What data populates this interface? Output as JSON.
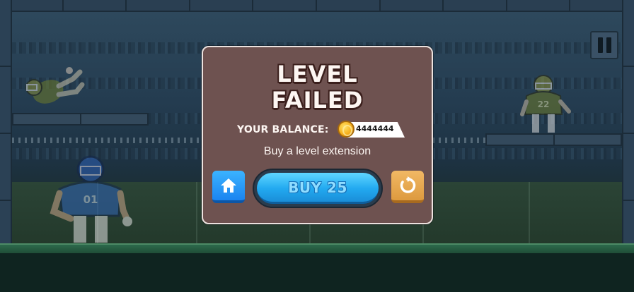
{
  "hud": {
    "pause_icon": "pause-icon"
  },
  "modal": {
    "title_line1": "LEVEL",
    "title_line2": "FAILED",
    "balance_label": "YOUR BALANCE:",
    "balance_value": "4444444",
    "coin_icon": "coin-icon",
    "subtitle": "Buy a level extension",
    "buy_label": "BUY 25",
    "home_icon": "home-icon",
    "restart_icon": "restart-icon"
  },
  "players": {
    "main_number": "01",
    "opponent_number": "22"
  },
  "colors": {
    "modal_bg": "#6e5250",
    "buy_button": "#22a9f0",
    "home_button": "#1a84f0",
    "restart_button": "#dd9a3f",
    "home_jersey": "#2f62b8",
    "opponent_jersey": "#6d7a2a"
  }
}
